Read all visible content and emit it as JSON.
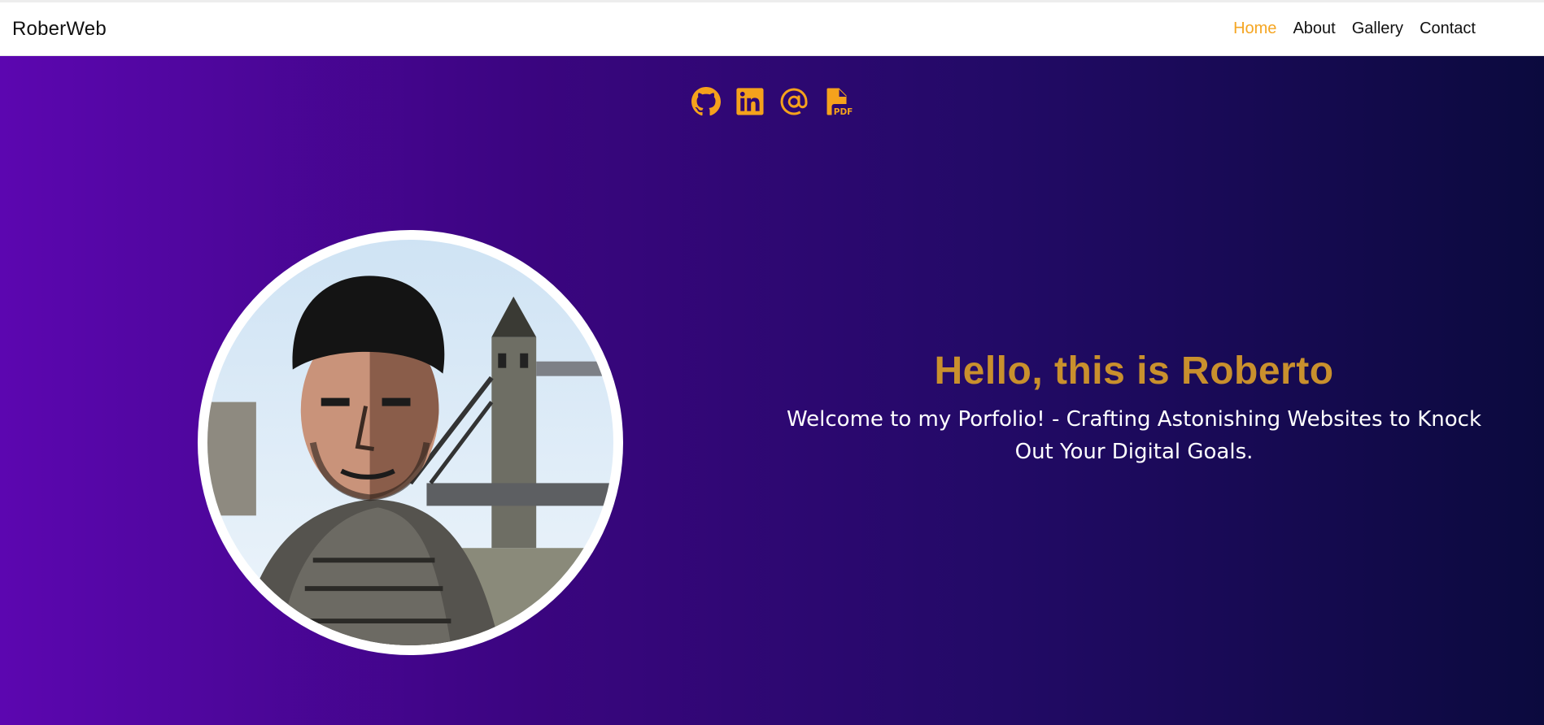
{
  "navbar": {
    "brand": "RoberWeb",
    "items": [
      {
        "label": "Home",
        "active": true
      },
      {
        "label": "About",
        "active": false
      },
      {
        "label": "Gallery",
        "active": false
      },
      {
        "label": "Contact",
        "active": false
      }
    ]
  },
  "social": [
    {
      "icon": "github-icon"
    },
    {
      "icon": "linkedin-icon"
    },
    {
      "icon": "at-sign-icon"
    },
    {
      "icon": "pdf-file-icon"
    }
  ],
  "hero": {
    "title": "Hello, this is Roberto",
    "subtitle": "Welcome to my Porfolio! - Crafting Astonishing Websites to Knock Out Your Digital Goals."
  },
  "colors": {
    "accent": "#f5a623",
    "title": "#c9902d",
    "gradient_start": "#5c06b0",
    "gradient_end": "#0b0a3e"
  }
}
